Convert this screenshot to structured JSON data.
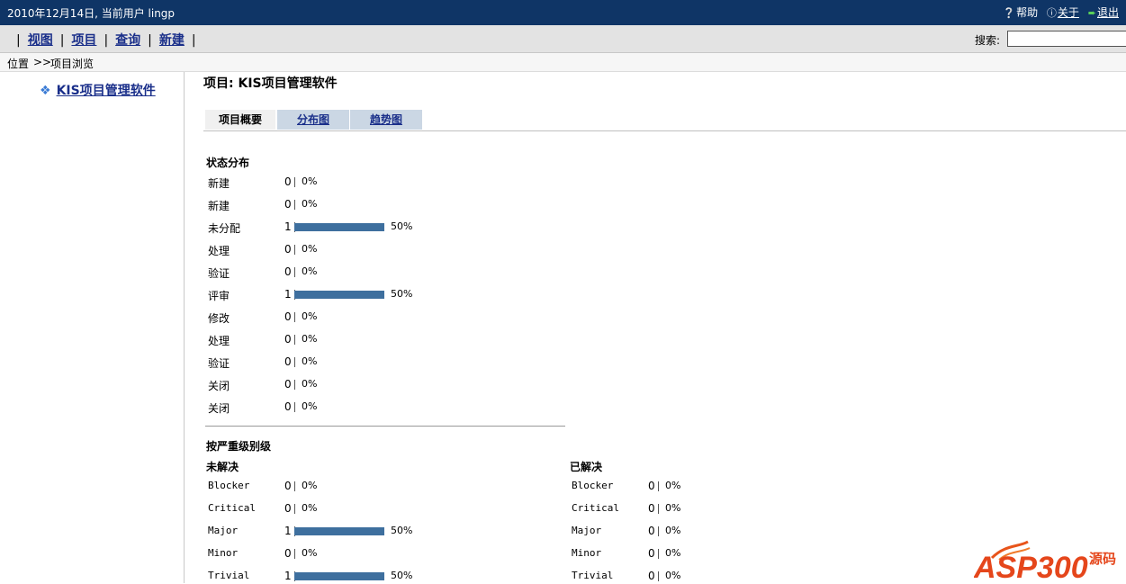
{
  "topbar": {
    "date_user": "2010年12月14日, 当前用户 lingp",
    "help": "帮助",
    "about": "关于",
    "exit": "退出",
    "exit_icon_text": "Exit"
  },
  "menu": {
    "items": [
      "视图",
      "项目",
      "查询",
      "新建"
    ],
    "separator": "|",
    "search_label": "搜索:",
    "search_value": ""
  },
  "breadcrumb": {
    "location": "位置",
    "arrow": ">>",
    "current": "项目浏览"
  },
  "sidebar": {
    "project_link": "KIS项目管理软件"
  },
  "main": {
    "title": "项目: KIS项目管理软件",
    "tabs": [
      "项目概要",
      "分布图",
      "趋势图"
    ],
    "status_title": "状态分布",
    "status_rows": [
      {
        "label": "新建",
        "count": 0,
        "percent": 0,
        "pct_text": "0%"
      },
      {
        "label": "新建",
        "count": 0,
        "percent": 0,
        "pct_text": "0%"
      },
      {
        "label": "未分配",
        "count": 1,
        "percent": 50,
        "pct_text": "50%"
      },
      {
        "label": "处理",
        "count": 0,
        "percent": 0,
        "pct_text": "0%"
      },
      {
        "label": "验证",
        "count": 0,
        "percent": 0,
        "pct_text": "0%"
      },
      {
        "label": "评审",
        "count": 1,
        "percent": 50,
        "pct_text": "50%"
      },
      {
        "label": "修改",
        "count": 0,
        "percent": 0,
        "pct_text": "0%"
      },
      {
        "label": "处理",
        "count": 0,
        "percent": 0,
        "pct_text": "0%"
      },
      {
        "label": "验证",
        "count": 0,
        "percent": 0,
        "pct_text": "0%"
      },
      {
        "label": "关闭",
        "count": 0,
        "percent": 0,
        "pct_text": "0%"
      },
      {
        "label": "关闭",
        "count": 0,
        "percent": 0,
        "pct_text": "0%"
      }
    ],
    "severity_title": "按严重级别级",
    "unresolved_title": "未解决",
    "resolved_title": "已解决",
    "unresolved_rows": [
      {
        "label": "Blocker",
        "count": 0,
        "percent": 0,
        "pct_text": "0%"
      },
      {
        "label": "Critical",
        "count": 0,
        "percent": 0,
        "pct_text": "0%"
      },
      {
        "label": "Major",
        "count": 1,
        "percent": 50,
        "pct_text": "50%"
      },
      {
        "label": "Minor",
        "count": 0,
        "percent": 0,
        "pct_text": "0%"
      },
      {
        "label": "Trivial",
        "count": 1,
        "percent": 50,
        "pct_text": "50%"
      }
    ],
    "resolved_rows": [
      {
        "label": "Blocker",
        "count": 0,
        "percent": 0,
        "pct_text": "0%"
      },
      {
        "label": "Critical",
        "count": 0,
        "percent": 0,
        "pct_text": "0%"
      },
      {
        "label": "Major",
        "count": 0,
        "percent": 0,
        "pct_text": "0%"
      },
      {
        "label": "Minor",
        "count": 0,
        "percent": 0,
        "pct_text": "0%"
      },
      {
        "label": "Trivial",
        "count": 0,
        "percent": 0,
        "pct_text": "0%"
      }
    ]
  },
  "watermark": {
    "brand": "ASP300",
    "suffix": "源码"
  },
  "colors": {
    "topbar_bg": "#0f3566",
    "bar_fill": "#3e6f9e",
    "link": "#1a2f8a",
    "tab_bg": "#cbd7e4"
  }
}
